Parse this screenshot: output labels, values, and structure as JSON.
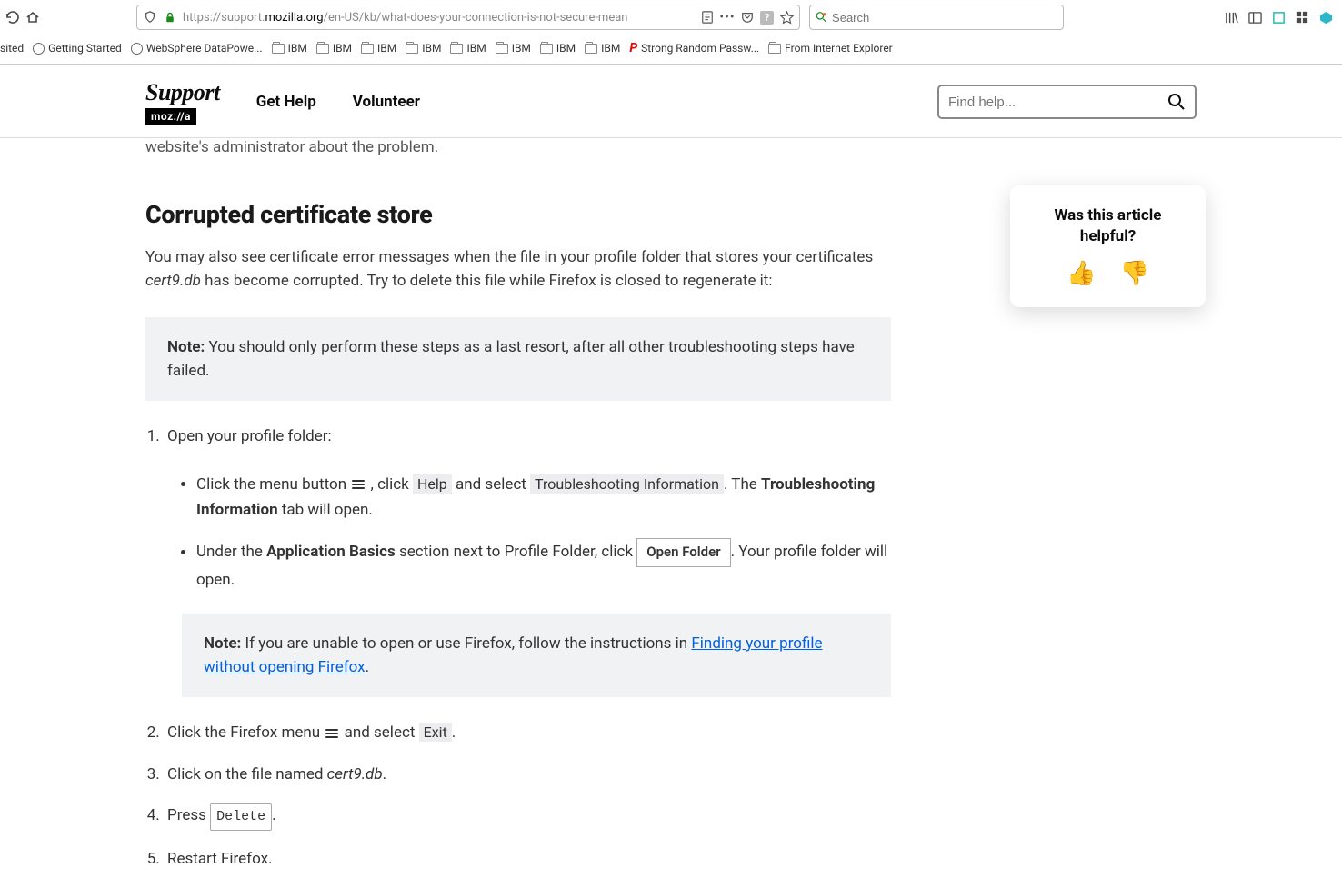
{
  "browser": {
    "url_prefix": "https://support.",
    "url_domain": "mozilla.org",
    "url_path": "/en-US/kb/what-does-your-connection-is-not-secure-mean",
    "search_placeholder": "Search",
    "bookmarks": [
      {
        "label": "sited",
        "icon": "none"
      },
      {
        "label": "Getting Started",
        "icon": "globe"
      },
      {
        "label": "WebSphere DataPowe...",
        "icon": "globe"
      },
      {
        "label": "IBM",
        "icon": "folder"
      },
      {
        "label": "IBM",
        "icon": "folder"
      },
      {
        "label": "IBM",
        "icon": "folder"
      },
      {
        "label": "IBM",
        "icon": "folder"
      },
      {
        "label": "IBM",
        "icon": "folder"
      },
      {
        "label": "IBM",
        "icon": "folder"
      },
      {
        "label": "IBM",
        "icon": "folder"
      },
      {
        "label": "IBM",
        "icon": "folder"
      },
      {
        "label": "Strong Random Passw...",
        "icon": "p"
      },
      {
        "label": "From Internet Explorer",
        "icon": "folder"
      }
    ]
  },
  "header": {
    "logo_top": "Support",
    "logo_bottom": "moz://a",
    "nav": [
      "Get Help",
      "Volunteer"
    ],
    "search_placeholder": "Find help..."
  },
  "article": {
    "cutoff_text": "website's administrator about the problem.",
    "h2": "Corrupted certificate store",
    "p1_a": "You may also see certificate error messages when the file in your profile folder that stores your certificates ",
    "p1_file": "cert9.db",
    "p1_b": " has become corrupted. Try to delete this file while Firefox is closed to regenerate it:",
    "note1_label": "Note:",
    "note1_text": " You should only perform these steps as a last resort, after all other troubleshooting steps have failed.",
    "step1": "Open your profile folder:",
    "sub1_a": "Click the menu button ",
    "sub1_b": ", click ",
    "sub1_help": "Help",
    "sub1_c": " and select ",
    "sub1_tinfo": "Troubleshooting Information",
    "sub1_d": ". The ",
    "sub1_tinfo2": "Troubleshooting Information",
    "sub1_e": " tab will open.",
    "sub2_a": "Under the ",
    "sub2_ab": "Application Basics",
    "sub2_b": " section next to Profile Folder, click ",
    "sub2_btn": "Open Folder",
    "sub2_c": ". Your profile folder will open.",
    "note2_label": "Note:",
    "note2_a": " If you are unable to open or use Firefox, follow the instructions in ",
    "note2_link": "Finding your profile without opening Firefox",
    "note2_b": ".",
    "step2_a": "Click the Firefox menu ",
    "step2_b": " and select ",
    "step2_exit": "Exit",
    "step2_c": ".",
    "step3_a": "Click on the file named ",
    "step3_file": "cert9.db",
    "step3_b": ".",
    "step4_a": "Press ",
    "step4_key": "Delete",
    "step4_b": ".",
    "step5": "Restart Firefox."
  },
  "feedback": {
    "title": "Was this article helpful?"
  }
}
